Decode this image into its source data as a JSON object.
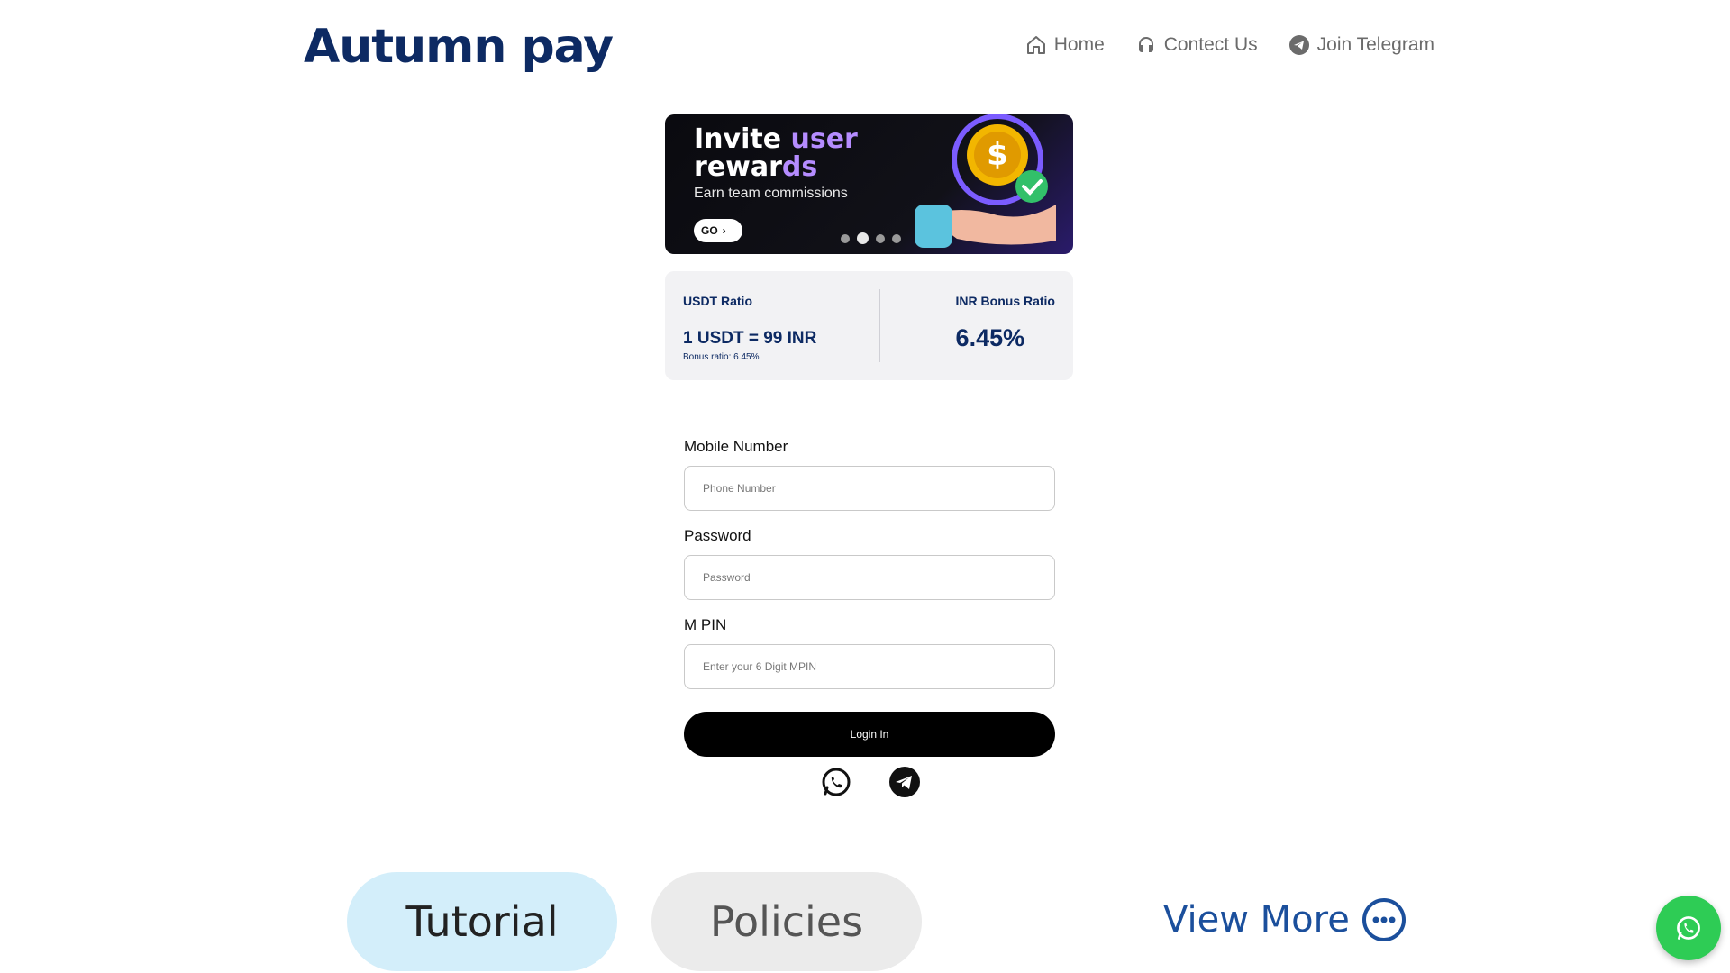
{
  "brand": {
    "name": "Autumn pay"
  },
  "nav": {
    "items": [
      {
        "label": "Home",
        "icon": "home-icon"
      },
      {
        "label": "Contect Us",
        "icon": "headset-icon"
      },
      {
        "label": "Join Telegram",
        "icon": "telegram-icon"
      }
    ]
  },
  "banner": {
    "title_line1_a": "Invite ",
    "title_line1_b": "user",
    "title_line2_a": "rewar",
    "title_line2_b": "ds",
    "subtitle": "Earn team commissions",
    "go_label": "GO",
    "slide_count": 4,
    "active_slide": 2
  },
  "ratio": {
    "usdt_label": "USDT Ratio",
    "usdt_value": "1 USDT = 99 INR",
    "bonus_small": "Bonus ratio: 6.45%",
    "inr_label": "INR Bonus Ratio",
    "inr_value": "6.45%"
  },
  "form": {
    "mobile_label": "Mobile Number",
    "mobile_placeholder": "Phone Number",
    "password_label": "Password",
    "password_placeholder": "Password",
    "mpin_label": "M PIN",
    "mpin_placeholder": "Enter your 6 Digit MPIN",
    "login_label": "Login In"
  },
  "social": {
    "icons": [
      "whatsapp-icon",
      "telegram-icon"
    ]
  },
  "bottom": {
    "tutorial_label": "Tutorial",
    "policies_label": "Policies",
    "view_more_label": "View More"
  },
  "colors": {
    "brand": "#0d2a63",
    "fab": "#2ecc55",
    "view_more": "#1b4f9c"
  }
}
